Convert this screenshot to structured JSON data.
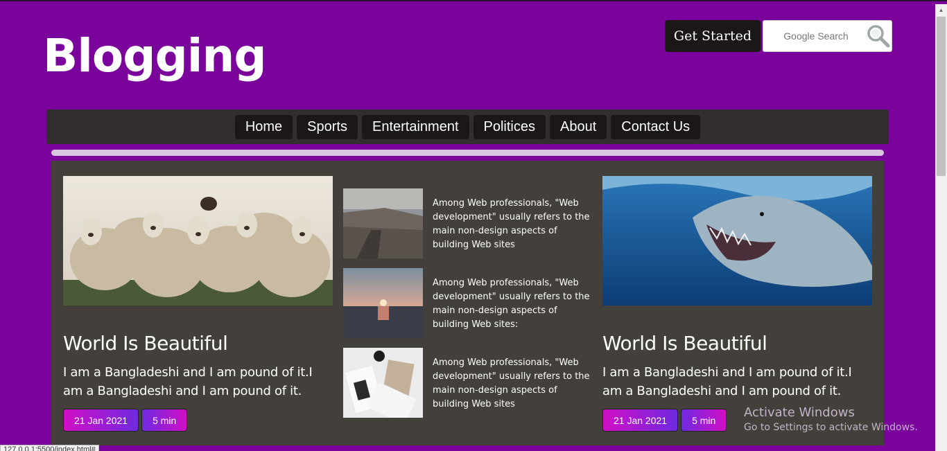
{
  "header": {
    "logo": "Blogging",
    "get_started": "Get Started",
    "search_placeholder": "Google Search"
  },
  "nav": [
    "Home",
    "Sports",
    "Entertainment",
    "Politices",
    "About",
    "Contact Us"
  ],
  "cards": [
    {
      "title": "World Is Beautiful",
      "text": "I am a Bangladeshi and I am pound of it.I am a Bangladeshi and I am pound of it.",
      "date": "21 Jan 2021",
      "read": "5 min"
    },
    {
      "title": "World Is Beautiful",
      "text": "I am a Bangladeshi and I am pound of it.I am a Bangladeshi and I am pound of it.",
      "date": "21 Jan 2021",
      "read": "5 min"
    }
  ],
  "middle": [
    {
      "text": "Among Web professionals, \"Web development\" usually refers to the main non-design aspects of building Web sites"
    },
    {
      "text": "Among Web professionals, \"Web development\" usually refers to the main non-design aspects of building Web sites:"
    },
    {
      "text": "Among Web professionals, \"Web development\" usually refers to the main non-design aspects of building Web sites"
    }
  ],
  "watermark": {
    "line1": "Activate Windows",
    "line2": "Go to Settings to activate Windows."
  },
  "status_url": "127.0.0.1:5500/index.html#"
}
